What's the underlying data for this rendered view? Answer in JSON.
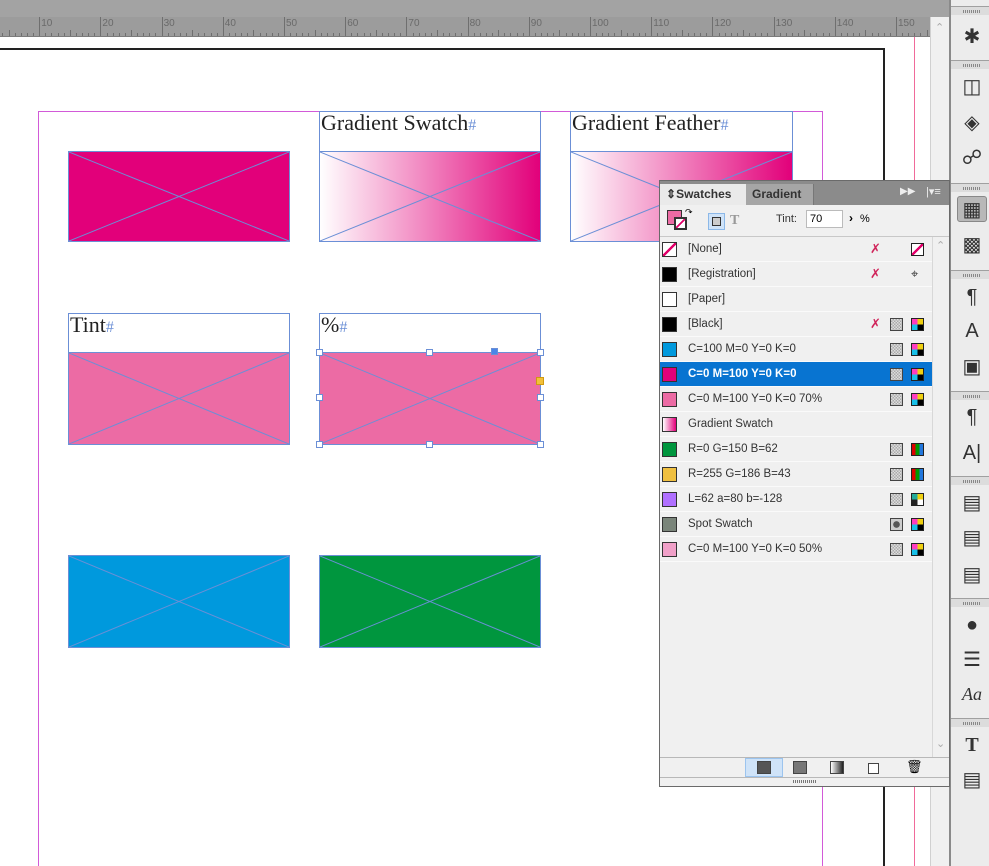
{
  "ruler": {
    "labels": [
      "10",
      "20",
      "30",
      "40",
      "50",
      "60",
      "70",
      "80",
      "90",
      "100",
      "110",
      "120",
      "130",
      "140",
      "150"
    ]
  },
  "canvas": {
    "frames": {
      "gradient_swatch_label": "Gradient Swatch",
      "gradient_feather_label": "Gradient Feather",
      "tint_label": "Tint",
      "percent_label": "%",
      "hash": "#"
    },
    "colors": {
      "magenta": "#e2007a",
      "tint70": "#ec6ba4",
      "cyan": "#0099dd",
      "green": "#00963e"
    }
  },
  "swatches_panel": {
    "tabs": [
      "Swatches",
      "Gradient"
    ],
    "tint_label": "Tint:",
    "tint_value": "70",
    "percent": "%",
    "rows": [
      {
        "name": "[None]",
        "color": "none"
      },
      {
        "name": "[Registration]",
        "color": "#000000"
      },
      {
        "name": "[Paper]",
        "color": "#ffffff"
      },
      {
        "name": "[Black]",
        "color": "#000000"
      },
      {
        "name": "C=100 M=0 Y=0 K=0",
        "color": "#0099dd"
      },
      {
        "name": "C=0 M=100 Y=0 K=0",
        "color": "#e2007a",
        "selected": true
      },
      {
        "name": "C=0 M=100 Y=0 K=0 70%",
        "color": "#ec6ba4"
      },
      {
        "name": "Gradient Swatch",
        "color": "gradient"
      },
      {
        "name": "R=0 G=150 B=62",
        "color": "#00963e"
      },
      {
        "name": "R=255 G=186 B=43",
        "color": "#f0c040"
      },
      {
        "name": "L=62 a=80 b=-128",
        "color": "#b070ff"
      },
      {
        "name": "Spot Swatch",
        "color": "#7a857a"
      },
      {
        "name": "C=0 M=100 Y=0 K=0 50%",
        "color": "#f0a0c8"
      }
    ]
  }
}
